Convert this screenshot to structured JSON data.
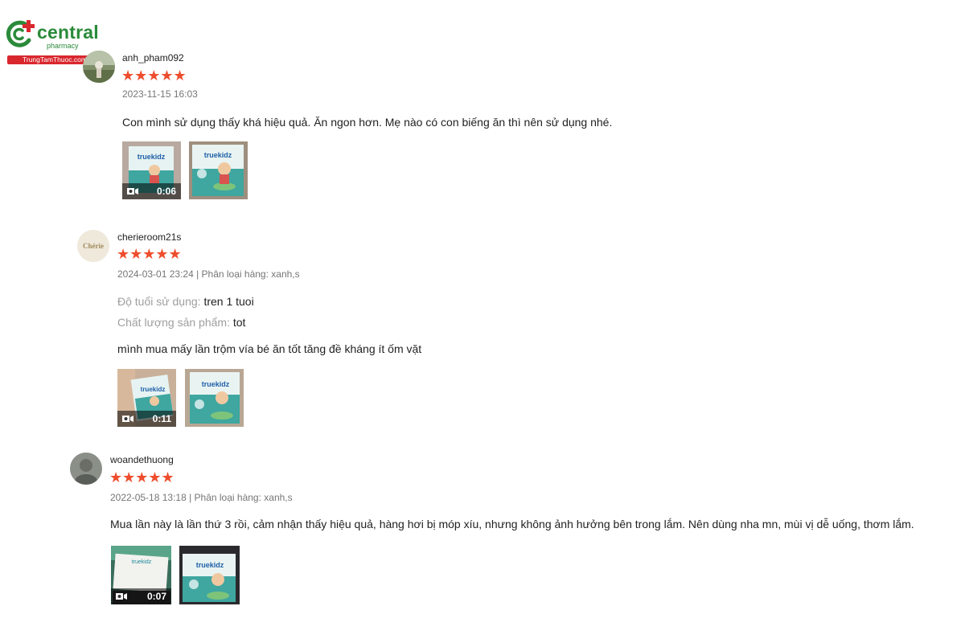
{
  "logo": {
    "brand": "central",
    "sub": "pharmacy",
    "bar_text": "TrungTamThuoc.com",
    "colors": {
      "green": "#2a8a3a",
      "red": "#d9272e"
    }
  },
  "star_color": "#ee4d2d",
  "reviews": [
    {
      "username": "anh_pham092",
      "rating": 5,
      "stars": "★★★★★",
      "meta": "2023-11-15 16:03",
      "comment": "Con mình sử dụng thấy khá hiệu quả. Ăn ngon hơn. Mẹ nào có con biếng ăn thì nên sử dụng nhé.",
      "media": [
        {
          "type": "video",
          "duration": "0:06",
          "icon": "video-camera-icon"
        },
        {
          "type": "image"
        }
      ]
    },
    {
      "username": "cherieroom21s",
      "avatar_text": "Chérie",
      "rating": 5,
      "stars": "★★★★★",
      "meta": "2024-03-01 23:24 | Phân loại hàng: xanh,s",
      "attributes": [
        {
          "label": "Độ tuổi sử dụng:",
          "value": "tren 1 tuoi"
        },
        {
          "label": "Chất lượng sản phẩm:",
          "value": "tot"
        }
      ],
      "comment": "mình mua mấy lần trộm vía bé ăn tốt tăng đề kháng ít ốm vặt",
      "media": [
        {
          "type": "video",
          "duration": "0:11",
          "icon": "video-camera-icon"
        },
        {
          "type": "image"
        }
      ]
    },
    {
      "username": "woandethuong",
      "rating": 5,
      "stars": "★★★★★",
      "meta": "2022-05-18 13:18 | Phân loại hàng: xanh,s",
      "comment": "Mua lần này là lần thứ 3 rồi, cảm nhận thấy hiệu quả, hàng hơi bị móp xíu, nhưng không ảnh hưởng bên trong lắm. Nên dùng nha mn, mùi vị dễ uống, thơm lắm.",
      "media": [
        {
          "type": "video",
          "duration": "0:07",
          "icon": "video-camera-icon"
        },
        {
          "type": "image"
        }
      ]
    }
  ]
}
